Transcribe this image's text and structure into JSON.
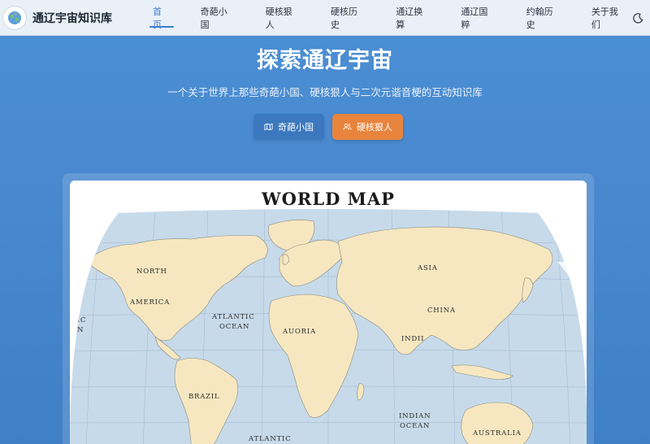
{
  "navbar": {
    "site_title": "通辽宇宙知识库",
    "links": [
      {
        "label": "首页",
        "active": true
      },
      {
        "label": "奇葩小国",
        "active": false
      },
      {
        "label": "硬核狠人",
        "active": false
      },
      {
        "label": "硬核历史",
        "active": false
      },
      {
        "label": "通辽换算",
        "active": false
      },
      {
        "label": "通辽国粹",
        "active": false
      },
      {
        "label": "约翰历史",
        "active": false
      },
      {
        "label": "关于我们",
        "active": false
      }
    ],
    "logo_icon": "globe-icon",
    "theme_icon": "moon-icon"
  },
  "hero": {
    "title": "探索通辽宇宙",
    "subtitle": "一个关于世界上那些奇葩小国、硬核狠人与二次元谐音梗的互动知识库",
    "buttons": [
      {
        "label": "奇葩小国",
        "icon": "map-icon",
        "color": "#3b78bd"
      },
      {
        "label": "硬核狠人",
        "icon": "users-icon",
        "color": "#e8843d"
      }
    ]
  },
  "map": {
    "title": "WORLD MAP",
    "labels": {
      "north": "NORTH",
      "america": "AMERICA",
      "atlantic1": "ATLANTIC",
      "ocean1": "OCEAN",
      "pacific": "FIC",
      "pacific2": "AN",
      "auoria": "AUORIA",
      "asia": "ASIA",
      "china": "CHINA",
      "indii": "INDII",
      "brazil": "BRAZIL",
      "atlantic2": "ATLANTIC",
      "indian": "INDIAN",
      "ocean2": "OCEAN",
      "australia": "AUSTRALIA"
    },
    "colors": {
      "ocean": "#c7daea",
      "land": "#f6e7c1",
      "grid": "#9fb7cc",
      "border": "#8a8a7a"
    }
  }
}
